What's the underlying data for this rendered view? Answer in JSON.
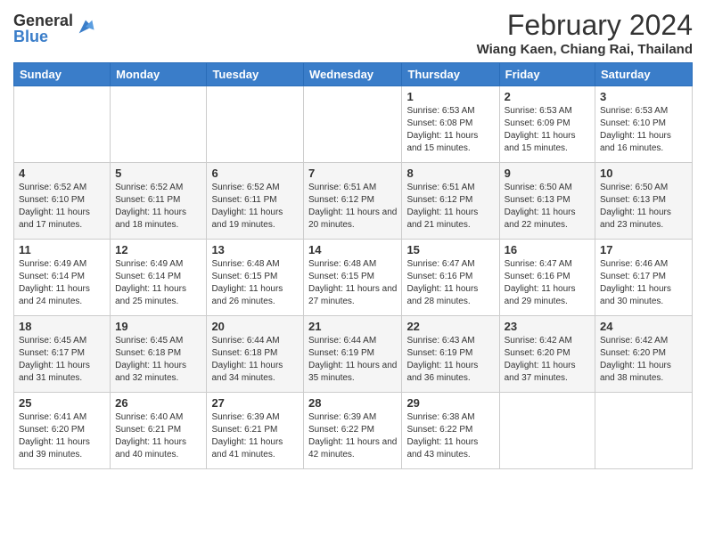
{
  "logo": {
    "general": "General",
    "blue": "Blue"
  },
  "title": "February 2024",
  "subtitle": "Wiang Kaen, Chiang Rai, Thailand",
  "days_of_week": [
    "Sunday",
    "Monday",
    "Tuesday",
    "Wednesday",
    "Thursday",
    "Friday",
    "Saturday"
  ],
  "weeks": [
    [
      {
        "day": "",
        "info": ""
      },
      {
        "day": "",
        "info": ""
      },
      {
        "day": "",
        "info": ""
      },
      {
        "day": "",
        "info": ""
      },
      {
        "day": "1",
        "info": "Sunrise: 6:53 AM\nSunset: 6:08 PM\nDaylight: 11 hours and 15 minutes."
      },
      {
        "day": "2",
        "info": "Sunrise: 6:53 AM\nSunset: 6:09 PM\nDaylight: 11 hours and 15 minutes."
      },
      {
        "day": "3",
        "info": "Sunrise: 6:53 AM\nSunset: 6:10 PM\nDaylight: 11 hours and 16 minutes."
      }
    ],
    [
      {
        "day": "4",
        "info": "Sunrise: 6:52 AM\nSunset: 6:10 PM\nDaylight: 11 hours and 17 minutes."
      },
      {
        "day": "5",
        "info": "Sunrise: 6:52 AM\nSunset: 6:11 PM\nDaylight: 11 hours and 18 minutes."
      },
      {
        "day": "6",
        "info": "Sunrise: 6:52 AM\nSunset: 6:11 PM\nDaylight: 11 hours and 19 minutes."
      },
      {
        "day": "7",
        "info": "Sunrise: 6:51 AM\nSunset: 6:12 PM\nDaylight: 11 hours and 20 minutes."
      },
      {
        "day": "8",
        "info": "Sunrise: 6:51 AM\nSunset: 6:12 PM\nDaylight: 11 hours and 21 minutes."
      },
      {
        "day": "9",
        "info": "Sunrise: 6:50 AM\nSunset: 6:13 PM\nDaylight: 11 hours and 22 minutes."
      },
      {
        "day": "10",
        "info": "Sunrise: 6:50 AM\nSunset: 6:13 PM\nDaylight: 11 hours and 23 minutes."
      }
    ],
    [
      {
        "day": "11",
        "info": "Sunrise: 6:49 AM\nSunset: 6:14 PM\nDaylight: 11 hours and 24 minutes."
      },
      {
        "day": "12",
        "info": "Sunrise: 6:49 AM\nSunset: 6:14 PM\nDaylight: 11 hours and 25 minutes."
      },
      {
        "day": "13",
        "info": "Sunrise: 6:48 AM\nSunset: 6:15 PM\nDaylight: 11 hours and 26 minutes."
      },
      {
        "day": "14",
        "info": "Sunrise: 6:48 AM\nSunset: 6:15 PM\nDaylight: 11 hours and 27 minutes."
      },
      {
        "day": "15",
        "info": "Sunrise: 6:47 AM\nSunset: 6:16 PM\nDaylight: 11 hours and 28 minutes."
      },
      {
        "day": "16",
        "info": "Sunrise: 6:47 AM\nSunset: 6:16 PM\nDaylight: 11 hours and 29 minutes."
      },
      {
        "day": "17",
        "info": "Sunrise: 6:46 AM\nSunset: 6:17 PM\nDaylight: 11 hours and 30 minutes."
      }
    ],
    [
      {
        "day": "18",
        "info": "Sunrise: 6:45 AM\nSunset: 6:17 PM\nDaylight: 11 hours and 31 minutes."
      },
      {
        "day": "19",
        "info": "Sunrise: 6:45 AM\nSunset: 6:18 PM\nDaylight: 11 hours and 32 minutes."
      },
      {
        "day": "20",
        "info": "Sunrise: 6:44 AM\nSunset: 6:18 PM\nDaylight: 11 hours and 34 minutes."
      },
      {
        "day": "21",
        "info": "Sunrise: 6:44 AM\nSunset: 6:19 PM\nDaylight: 11 hours and 35 minutes."
      },
      {
        "day": "22",
        "info": "Sunrise: 6:43 AM\nSunset: 6:19 PM\nDaylight: 11 hours and 36 minutes."
      },
      {
        "day": "23",
        "info": "Sunrise: 6:42 AM\nSunset: 6:20 PM\nDaylight: 11 hours and 37 minutes."
      },
      {
        "day": "24",
        "info": "Sunrise: 6:42 AM\nSunset: 6:20 PM\nDaylight: 11 hours and 38 minutes."
      }
    ],
    [
      {
        "day": "25",
        "info": "Sunrise: 6:41 AM\nSunset: 6:20 PM\nDaylight: 11 hours and 39 minutes."
      },
      {
        "day": "26",
        "info": "Sunrise: 6:40 AM\nSunset: 6:21 PM\nDaylight: 11 hours and 40 minutes."
      },
      {
        "day": "27",
        "info": "Sunrise: 6:39 AM\nSunset: 6:21 PM\nDaylight: 11 hours and 41 minutes."
      },
      {
        "day": "28",
        "info": "Sunrise: 6:39 AM\nSunset: 6:22 PM\nDaylight: 11 hours and 42 minutes."
      },
      {
        "day": "29",
        "info": "Sunrise: 6:38 AM\nSunset: 6:22 PM\nDaylight: 11 hours and 43 minutes."
      },
      {
        "day": "",
        "info": ""
      },
      {
        "day": "",
        "info": ""
      }
    ]
  ]
}
